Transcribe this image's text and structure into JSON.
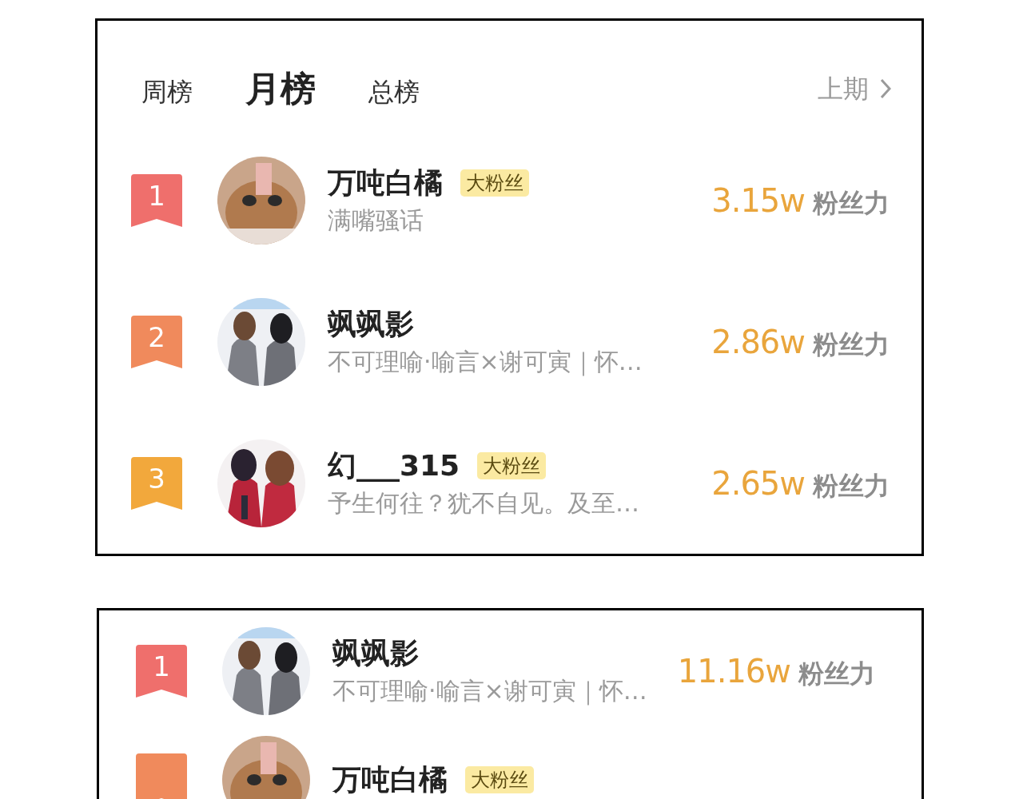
{
  "panels": [
    {
      "tabs": [
        {
          "label": "周榜",
          "selected": false
        },
        {
          "label": "月榜",
          "selected": true
        },
        {
          "label": "总榜",
          "selected": false
        }
      ],
      "previous_link": {
        "label": "上期"
      },
      "rows": [
        {
          "rank": "1",
          "color": "#ef6f6c",
          "name": "万吨白橘",
          "badge": "大粉丝",
          "bio": "满嘴骚话",
          "score": "3.15w",
          "score_label": "粉丝力"
        },
        {
          "rank": "2",
          "color": "#f08a5c",
          "name": "飒飒影",
          "bio": "不可理喻·喻言×谢可寅｜怀…",
          "score": "2.86w",
          "score_label": "粉丝力"
        },
        {
          "rank": "3",
          "color": "#f2a83c",
          "name": "幻___315",
          "badge": "大粉丝",
          "bio": "予生何往？犹不自见。及至…",
          "score": "2.65w",
          "score_label": "粉丝力"
        }
      ]
    },
    {
      "rows": [
        {
          "rank": "1",
          "color": "#ef6f6c",
          "name": "飒飒影",
          "bio": "不可理喻·喻言×谢可寅｜怀…",
          "score": "11.16w",
          "score_label": "粉丝力"
        },
        {
          "color": "#f08a5c",
          "name": "万吨白橘",
          "badge": "大粉丝"
        }
      ]
    }
  ]
}
